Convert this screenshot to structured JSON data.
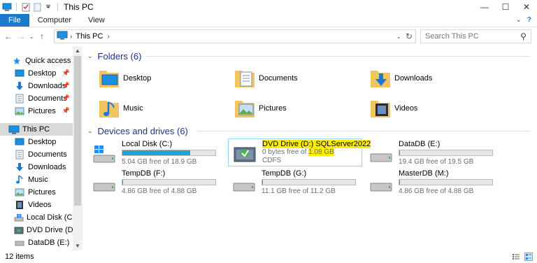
{
  "window": {
    "title": "This PC",
    "minimize": "—",
    "maximize": "☐",
    "close": "✕"
  },
  "ribbon": {
    "tabs": [
      "File",
      "Computer",
      "View"
    ]
  },
  "nav": {
    "back": "←",
    "forward": "→",
    "recent": "⌄",
    "up": "↑",
    "breadcrumb": "This PC",
    "breadcrumb_chevron": "›",
    "search_placeholder": "Search This PC"
  },
  "sidebar": {
    "items": [
      {
        "label": "Quick access",
        "icon": "star-icon",
        "pinned": false
      },
      {
        "label": "Desktop",
        "icon": "desktop-folder-icon",
        "pinned": true
      },
      {
        "label": "Downloads",
        "icon": "downloads-arrow-icon",
        "pinned": true
      },
      {
        "label": "Documents",
        "icon": "documents-icon",
        "pinned": true
      },
      {
        "label": "Pictures",
        "icon": "pictures-icon",
        "pinned": true
      },
      {
        "label": "This PC",
        "icon": "this-pc-icon",
        "pinned": false,
        "selected": true
      },
      {
        "label": "Desktop",
        "icon": "desktop-folder-icon",
        "pinned": false
      },
      {
        "label": "Documents",
        "icon": "documents-icon",
        "pinned": false
      },
      {
        "label": "Downloads",
        "icon": "downloads-arrow-icon",
        "pinned": false
      },
      {
        "label": "Music",
        "icon": "music-icon",
        "pinned": false
      },
      {
        "label": "Pictures",
        "icon": "pictures-icon",
        "pinned": false
      },
      {
        "label": "Videos",
        "icon": "videos-icon",
        "pinned": false
      },
      {
        "label": "Local Disk (C:)",
        "icon": "windows-drive-icon",
        "pinned": false
      },
      {
        "label": "DVD Drive (D:) SC",
        "icon": "dvd-drive-icon",
        "pinned": false
      },
      {
        "label": "DataDB (E:)",
        "icon": "hard-drive-icon",
        "pinned": false
      }
    ]
  },
  "folders": {
    "header": "Folders (6)",
    "items": [
      {
        "label": "Desktop",
        "icon": "desktop-folder-icon"
      },
      {
        "label": "Documents",
        "icon": "documents-folder-icon"
      },
      {
        "label": "Downloads",
        "icon": "downloads-folder-icon"
      },
      {
        "label": "Music",
        "icon": "music-folder-icon"
      },
      {
        "label": "Pictures",
        "icon": "pictures-folder-icon"
      },
      {
        "label": "Videos",
        "icon": "videos-folder-icon"
      }
    ]
  },
  "drives": {
    "header": "Devices and drives (6)",
    "items": [
      {
        "name": "Local Disk (C:)",
        "free": "5.04 GB free of 18.9 GB",
        "used_fraction": 0.73,
        "icon": "windows-drive-icon"
      },
      {
        "name": "DVD Drive (D:) SQLServer2022",
        "free_prefix": "0 bytes free of ",
        "free_total": "1.08 GB",
        "fs": "CDFS",
        "icon": "dvd-drive-icon",
        "selected": true
      },
      {
        "name": "DataDB (E:)",
        "free": "19.4 GB free of 19.5 GB",
        "used_fraction": 0.005,
        "icon": "hard-drive-icon"
      },
      {
        "name": "TempDB (F:)",
        "free": "4.86 GB free of 4.88 GB",
        "used_fraction": 0.004,
        "icon": "hard-drive-icon"
      },
      {
        "name": "TempDB (G:)",
        "free": "11.1 GB free of 11.2 GB",
        "used_fraction": 0.009,
        "icon": "hard-drive-icon"
      },
      {
        "name": "MasterDB (M:)",
        "free": "4.86 GB free of 4.88 GB",
        "used_fraction": 0.004,
        "icon": "hard-drive-icon"
      }
    ]
  },
  "status": {
    "count": "12 items"
  },
  "colors": {
    "accent": "#1979ca",
    "bar_fill": "#26a0da",
    "highlight": "#ffee00",
    "header_text": "#1e3287"
  }
}
